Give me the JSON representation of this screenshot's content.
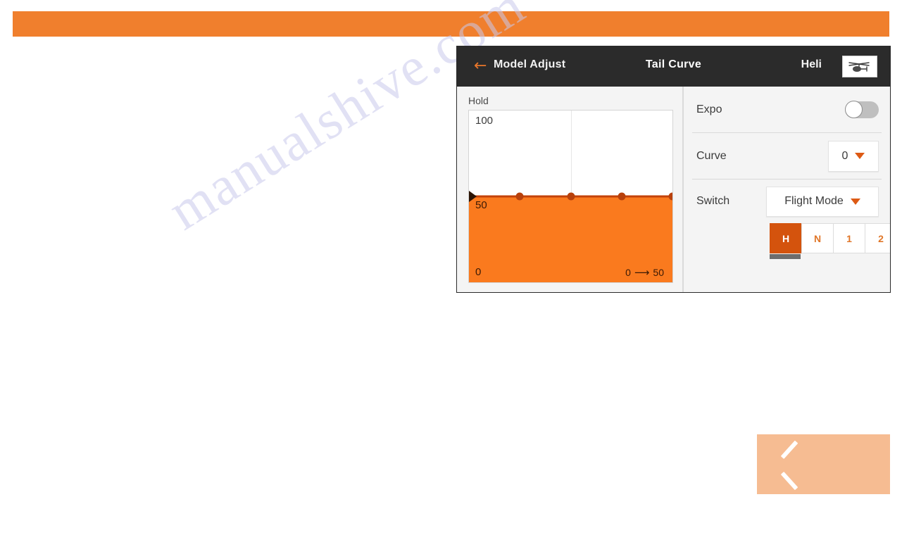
{
  "page": {
    "banner_color": "#f07f2d",
    "background_color": "#ffffff",
    "watermark_text": "manualshive.com"
  },
  "device": {
    "header": {
      "back_icon": "left-arrow-icon",
      "back_label": "Model Adjust",
      "title": "Tail Curve",
      "model_name": "Heli",
      "model_icon": "helicopter-icon"
    },
    "chart_panel": {
      "caption": "Hold",
      "label_top": "100",
      "label_mid": "50",
      "label_bottom": "0",
      "range_from": "0",
      "range_arrow": "⟶",
      "range_to": "50"
    },
    "settings": {
      "expo": {
        "label": "Expo",
        "toggle_state": "off"
      },
      "curve": {
        "label": "Curve",
        "value": "0",
        "caret_icon": "chevron-down-icon"
      },
      "switch": {
        "label": "Switch",
        "value": "Flight Mode",
        "caret_icon": "chevron-down-icon",
        "segments": [
          {
            "label": "H",
            "active": true
          },
          {
            "label": "N",
            "active": false
          },
          {
            "label": "1",
            "active": false
          },
          {
            "label": "2",
            "active": false
          }
        ]
      }
    },
    "colors": {
      "accent_orange": "#fa7a1e",
      "accent_dark_orange": "#d4530d",
      "header_dark": "#2b2b2b",
      "curve_line": "#c4430a"
    }
  },
  "nav": {
    "prev_label": "",
    "prev_icon": "chevron-left-icon",
    "prev_color": "#f6bc92"
  },
  "chart_data": {
    "type": "line",
    "title": "Hold",
    "xlabel": "",
    "ylabel": "",
    "xlim": [
      0,
      100
    ],
    "ylim": [
      0,
      100
    ],
    "grid": true,
    "yticks": [
      0,
      50,
      100
    ],
    "ytick_labels": [
      "0",
      "50",
      "100"
    ],
    "annotation": "0 ⟶ 50",
    "x": [
      0,
      25,
      50,
      75,
      100
    ],
    "values": [
      50,
      50,
      50,
      50,
      50
    ],
    "series": [
      {
        "name": "Tail Curve",
        "values": [
          50,
          50,
          50,
          50,
          50
        ]
      }
    ],
    "fill": "below",
    "fill_color": "#fa7a1e",
    "line_color": "#c4430a",
    "point_color": "#b8410c"
  }
}
